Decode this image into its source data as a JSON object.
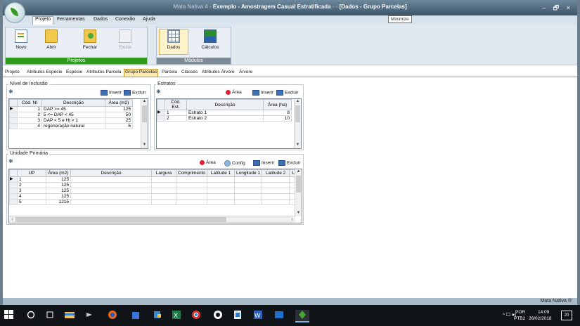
{
  "window": {
    "title_app": "Mata Nativa 4",
    "title_sep": " - ",
    "title_project": "Exemplo - Amostragem Casual Estratificada",
    "title_mid": " - - ",
    "title_doc": "[Dados - Grupo Parcelas]",
    "controls": "– 🗗 ×",
    "tooltip": "Minimize"
  },
  "menu": {
    "items": [
      "Projeto",
      "Ferramentas",
      "Dados",
      "Conexão",
      "Ajuda"
    ]
  },
  "ribbon": {
    "groups": [
      {
        "caption": "Projetos",
        "buttons": [
          "Novo",
          "Abrir",
          "Fechar",
          "Exclui"
        ]
      },
      {
        "caption": "Módulos",
        "buttons": [
          "Dados",
          "Cálculos"
        ]
      }
    ],
    "colors": {
      "projetos_caption": "#2f9a1e",
      "modulos_caption": "#7e8b96"
    }
  },
  "tabs": [
    "Projeto",
    "Atributos Espécie",
    "Espécie",
    "Atributos Parcela",
    "Grupo Parcelas",
    "Parcela",
    "Classes",
    "Atributos Árvore",
    "Árvore"
  ],
  "active_tab": "Grupo Parcelas",
  "nivel": {
    "legend": "Nível de Inclusão",
    "inserir": "Inserir",
    "excluir": "Excluir",
    "columns": [
      "Cód. NI",
      "Descrição",
      "Área (m2)"
    ],
    "rows": [
      {
        "cod": "1",
        "desc": "DAP >= 45",
        "area": "125"
      },
      {
        "cod": "2",
        "desc": "5 <= DAP < 45",
        "area": "50"
      },
      {
        "cod": "3",
        "desc": "DAP < 5 e Ht > 1",
        "area": "25"
      },
      {
        "cod": "4",
        "desc": "regeneração natural",
        "area": "5"
      }
    ]
  },
  "estratos": {
    "legend": "Estratos",
    "area": "Área",
    "inserir": "Inserir",
    "excluir": "Excluir",
    "columns": [
      "Cód. Est.",
      "Descrição",
      "Área (ha)"
    ],
    "rows": [
      {
        "cod": "1",
        "desc": "Estrato 1",
        "area": "8"
      },
      {
        "cod": "2",
        "desc": "Estrato 2",
        "area": "10"
      }
    ]
  },
  "unidade": {
    "legend": "Unidade Primária",
    "area": "Área",
    "config": "Config",
    "inserir": "Inserir",
    "excluir": "Excluir",
    "columns": [
      "UP",
      "Área (m2)",
      "Descrição",
      "Largura",
      "Comprimento",
      "Latitude 1",
      "Longitude 1",
      "Latitude 2",
      "L"
    ],
    "rows": [
      {
        "up": "1",
        "area": "125"
      },
      {
        "up": "2",
        "area": "125"
      },
      {
        "up": "3",
        "area": "125"
      },
      {
        "up": "4",
        "area": "125"
      },
      {
        "up": "5",
        "area": "1215"
      }
    ]
  },
  "statusbar": {
    "text": "Mata Nativa ®"
  },
  "taskbar": {
    "lang": "POR",
    "layout": "PTB2",
    "time": "14:09",
    "date": "26/02/2018",
    "notif_count": "20",
    "tray_icons": "^ 🖵 🕪)"
  }
}
